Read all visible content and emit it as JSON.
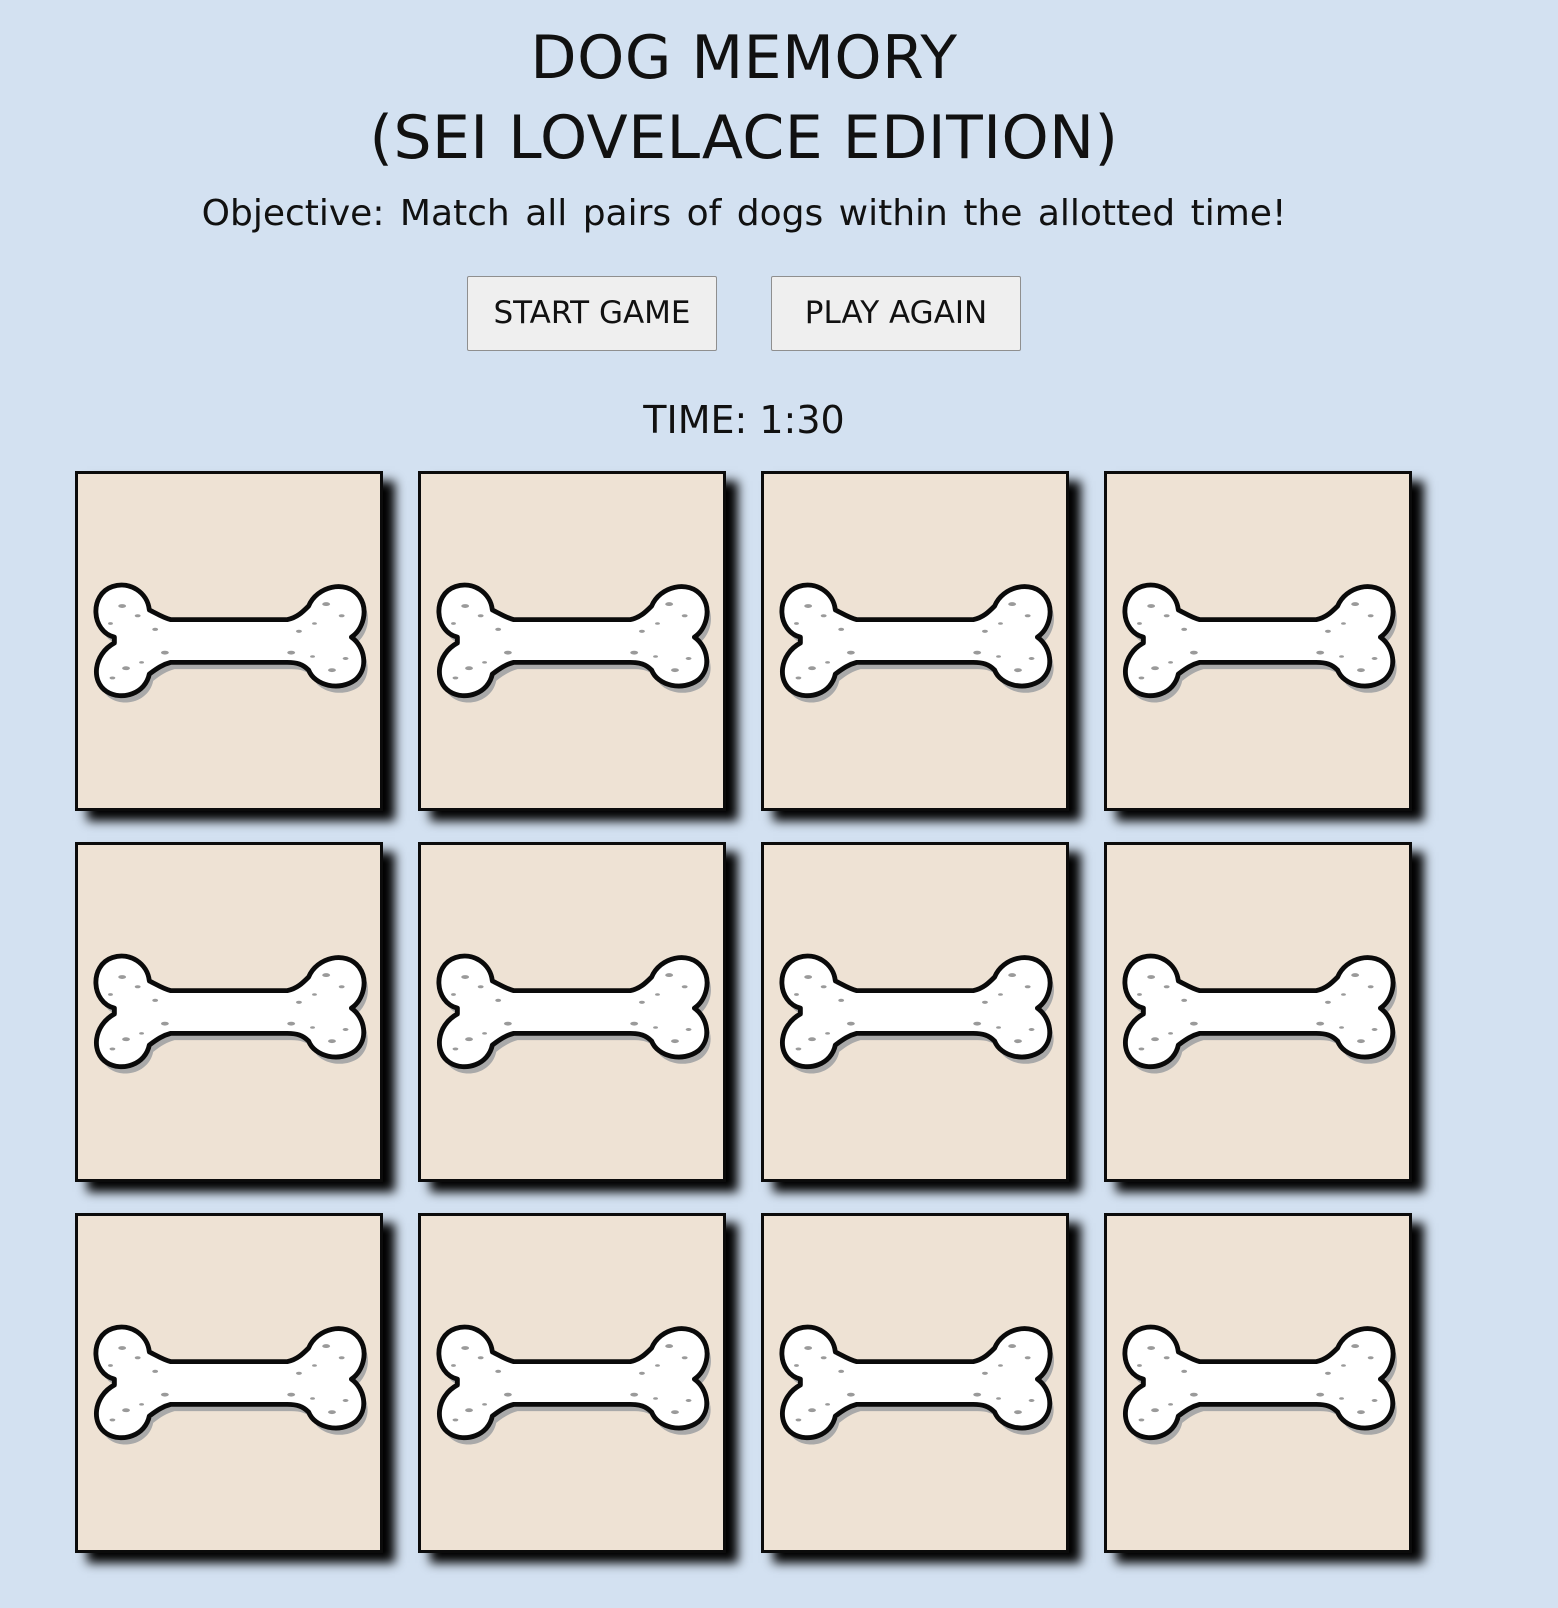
{
  "header": {
    "title_line1": "DOG MEMORY",
    "title_line2": "(SEI LOVELACE EDITION)",
    "objective": "Objective: Match all pairs of dogs within the allotted time!"
  },
  "controls": {
    "start_label": "START GAME",
    "play_again_label": "PLAY AGAIN"
  },
  "timer": {
    "text": "TIME: 1:30"
  },
  "board": {
    "rows": 3,
    "columns": 4,
    "cards": [
      {
        "state": "face-down",
        "icon": "bone-icon"
      },
      {
        "state": "face-down",
        "icon": "bone-icon"
      },
      {
        "state": "face-down",
        "icon": "bone-icon"
      },
      {
        "state": "face-down",
        "icon": "bone-icon"
      },
      {
        "state": "face-down",
        "icon": "bone-icon"
      },
      {
        "state": "face-down",
        "icon": "bone-icon"
      },
      {
        "state": "face-down",
        "icon": "bone-icon"
      },
      {
        "state": "face-down",
        "icon": "bone-icon"
      },
      {
        "state": "face-down",
        "icon": "bone-icon"
      },
      {
        "state": "face-down",
        "icon": "bone-icon"
      },
      {
        "state": "face-down",
        "icon": "bone-icon"
      },
      {
        "state": "face-down",
        "icon": "bone-icon"
      }
    ]
  },
  "colors": {
    "background": "#d3e1f1",
    "card_back": "#eee2d4",
    "card_border": "#0b0b0b",
    "bone_fill": "#ffffff",
    "button_bg": "#efefef"
  }
}
